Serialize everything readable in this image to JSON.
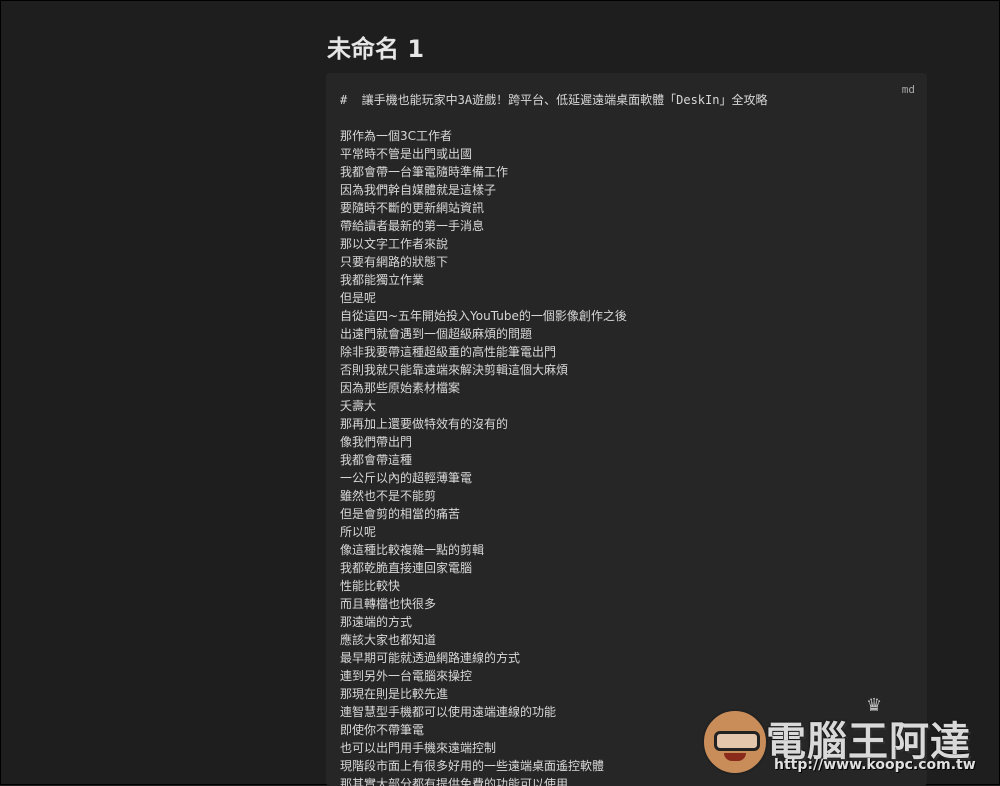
{
  "document": {
    "title": "未命名 1",
    "code_block": {
      "language": "md",
      "heading": "#  讓手機也能玩家中3A遊戲！跨平台、低延遲遠端桌面軟體「DeskIn」全攻略",
      "lines": [
        "那作為一個3C工作者",
        "平常時不管是出門或出國",
        "我都會帶一台筆電隨時準備工作",
        "因為我們幹自媒體就是這樣子",
        "要隨時不斷的更新網站資訊",
        "帶給讀者最新的第一手消息",
        "那以文字工作者來說",
        "只要有網路的狀態下",
        "我都能獨立作業",
        "但是呢",
        "自從這四~五年開始投入YouTube的一個影像創作之後",
        "出遠門就會遇到一個超級麻煩的問題",
        "除非我要帶這種超級重的高性能筆電出門",
        "否則我就只能靠遠端來解決剪輯這個大麻煩",
        "因為那些原始素材檔案",
        "夭壽大",
        "那再加上還要做特效有的沒有的",
        "像我們帶出門",
        "我都會帶這種",
        "一公斤以內的超輕薄筆電",
        "雖然也不是不能剪",
        "但是會剪的相當的痛苦",
        "所以呢",
        "像這種比較複雜一點的剪輯",
        "我都乾脆直接連回家電腦",
        "性能比較快",
        "而且轉檔也快很多",
        "那遠端的方式",
        "應該大家也都知道",
        "最早期可能就透過網路連線的方式",
        "連到另外一台電腦來操控",
        "那現在則是比較先進",
        "連智慧型手機都可以使用遠端連線的功能",
        "即使你不帶筆電",
        "也可以出門用手機來遠端控制",
        "現階段市面上有很多好用的一些遠端桌面遙控軟體",
        "那其實大部分都有提供免費的功能可以使用"
      ]
    }
  },
  "watermark": {
    "brand": "電腦王阿達",
    "url": "http://www.koopc.com.tw"
  },
  "colors": {
    "background": "#1e1e1e",
    "code_block_bg": "#262626",
    "text": "#d8d8d8",
    "title": "#e6e6e6"
  }
}
